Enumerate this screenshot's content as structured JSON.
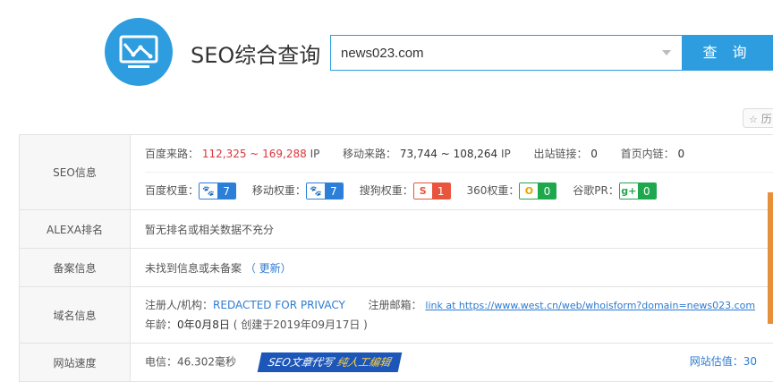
{
  "header": {
    "title": "SEO综合查询",
    "search_value": "news023.com",
    "search_button": "查 询",
    "history_label": "历"
  },
  "seo": {
    "label": "SEO信息",
    "baidu_traffic_label": "百度来路：",
    "baidu_traffic_value": "112,325 ~ 169,288",
    "baidu_traffic_unit": "IP",
    "mobile_traffic_label": "移动来路：",
    "mobile_traffic_value": "73,744 ~ 108,264",
    "mobile_traffic_unit": "IP",
    "outbound_label": "出站链接：",
    "outbound_value": "0",
    "home_internal_label": "首页内链：",
    "home_internal_value": "0",
    "ranks": [
      {
        "label": "百度权重：",
        "icon": "paw-icon",
        "glyph": "🐾",
        "value": "7",
        "color": "#2b7fd9"
      },
      {
        "label": "移动权重：",
        "icon": "paw-icon",
        "glyph": "🐾",
        "value": "7",
        "color": "#2b7fd9"
      },
      {
        "label": "搜狗权重：",
        "icon": "sogou-icon",
        "glyph": "S",
        "value": "1",
        "color": "#e8543c"
      },
      {
        "label": "360权重：",
        "icon": "360-icon",
        "glyph": "O",
        "value": "0",
        "color": "#1ea84d"
      },
      {
        "label": "谷歌PR：",
        "icon": "google-plus-icon",
        "glyph": "g+",
        "value": "0",
        "color": "#1ea84d"
      }
    ]
  },
  "alexa": {
    "label": "ALEXA排名",
    "text": "暂无排名或相关数据不充分"
  },
  "beian": {
    "label": "备案信息",
    "text": "未找到信息或未备案",
    "update_link": "（ 更新）"
  },
  "domain": {
    "label": "域名信息",
    "registrant_label": "注册人/机构：",
    "registrant_value": "REDACTED FOR PRIVACY",
    "email_label": "注册邮箱：",
    "email_link": "link at https://www.west.cn/web/whoisform?domain=news023.com",
    "age_label": "年龄：",
    "age_value": "0年0月8日",
    "created_text": "( 创建于2019年09月17日 )"
  },
  "speed": {
    "label": "网站速度",
    "telecom_label": "电信：",
    "telecom_value": "46.302毫秒",
    "banner_a": "SEO文章代写",
    "banner_b": "纯人工编辑",
    "estimate_label": "网站估值：30"
  }
}
